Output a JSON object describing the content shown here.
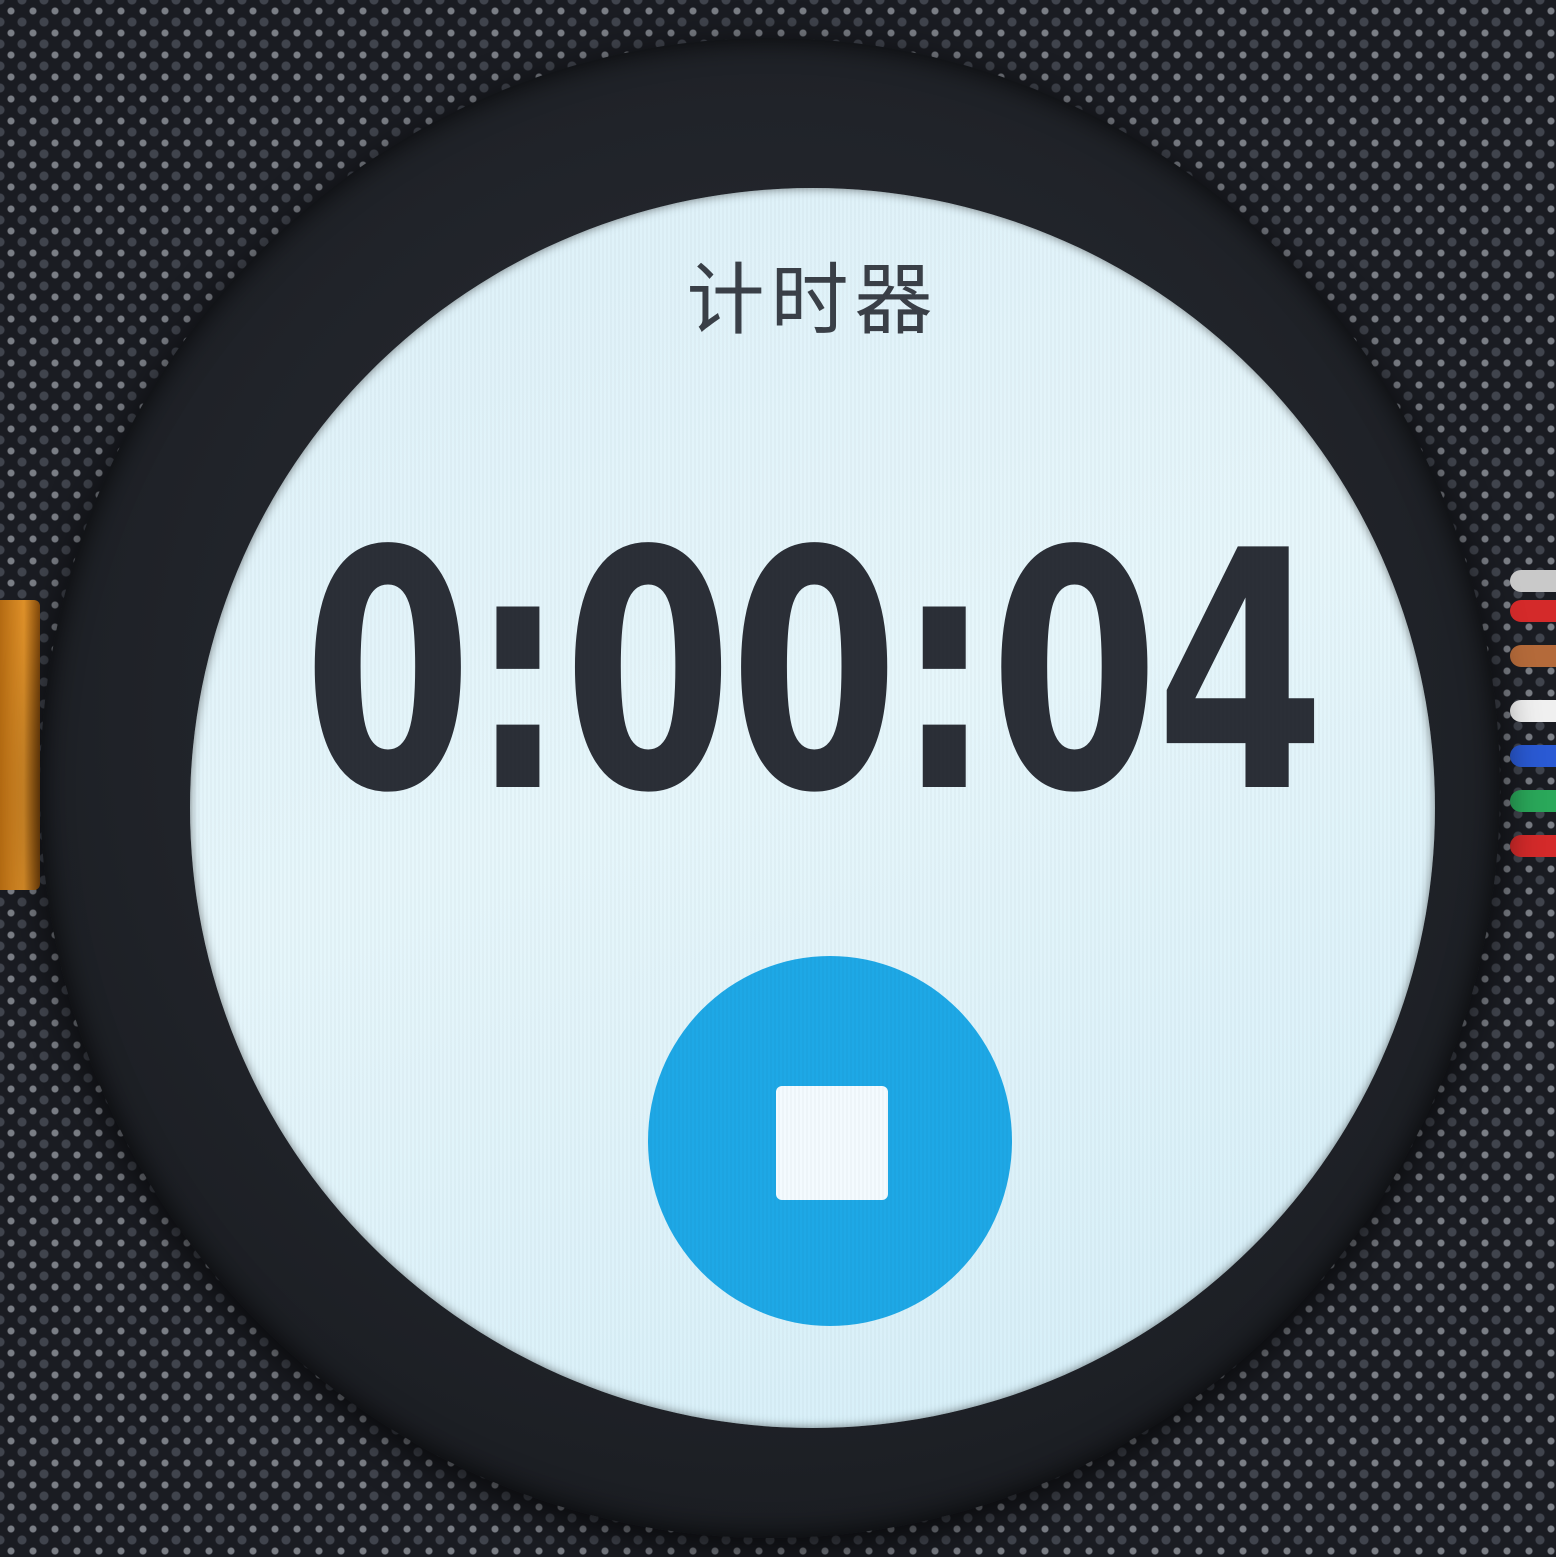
{
  "app": {
    "title": "计时器"
  },
  "timer": {
    "elapsed": "0:00:04"
  },
  "controls": {
    "stop_icon": "stop-icon",
    "accent_color": "#1ea8e6"
  }
}
